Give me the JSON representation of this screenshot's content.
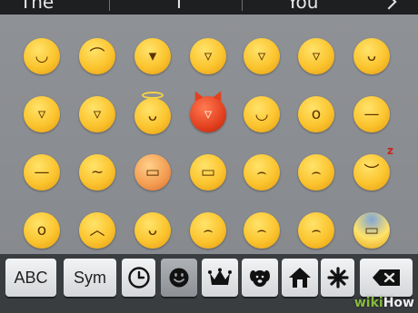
{
  "suggestions": {
    "words": [
      "The",
      "I",
      "You"
    ],
    "next_icon": "chevron-right-icon"
  },
  "emoji_grid": {
    "rows": [
      [
        "smile",
        "smiling-eyes",
        "grin",
        "big-grin",
        "laugh-tears",
        "grin-squint",
        "wink-tongue"
      ],
      [
        "sweat-smile",
        "laughing",
        "angel",
        "devil",
        "winking",
        "surprised",
        "neutral"
      ],
      [
        "expressionless",
        "confused",
        "angry",
        "grimace",
        "anger-vein",
        "crying",
        "sleeping"
      ],
      [
        "open-mouth",
        "persevere",
        "praying",
        "sad-sweat",
        "worried",
        "sigh",
        "scream-fear"
      ]
    ],
    "glyphs": {
      "smile": "◡",
      "smiling-eyes": "⌒",
      "grin": "▾",
      "big-grin": "▿",
      "laugh-tears": "▿",
      "grin-squint": "▿",
      "wink-tongue": "ᴗ",
      "sweat-smile": "▿",
      "laughing": "▿",
      "angel": "ᴗ",
      "devil": "▿",
      "winking": "◡",
      "surprised": "o",
      "neutral": "—",
      "expressionless": "—",
      "confused": "∼",
      "angry": "▭",
      "grimace": "▭",
      "anger-vein": "⌢",
      "crying": "⌢",
      "sleeping": "︶",
      "open-mouth": "o",
      "persevere": "︿",
      "praying": "ᴗ",
      "sad-sweat": "⌢",
      "worried": "⌢",
      "sigh": "⌢",
      "scream-fear": "▭"
    }
  },
  "keyboard": {
    "abc_label": "ABC",
    "sym_label": "Sym",
    "category_icons": [
      "clock-icon",
      "smiley-icon",
      "crown-icon",
      "dog-icon",
      "house-icon",
      "asterisk-icon"
    ],
    "active_category": "smiley-icon",
    "delete_icon": "backspace-icon"
  },
  "watermark": {
    "part1": "wiki",
    "part2": "How"
  },
  "colors": {
    "panel_bg": "#8e9195",
    "key_bg": "#eeeff0",
    "key_active_bg": "#9a9da1",
    "dark_bg": "#3a3d40",
    "emoji_yellow": "#fbc42e"
  }
}
